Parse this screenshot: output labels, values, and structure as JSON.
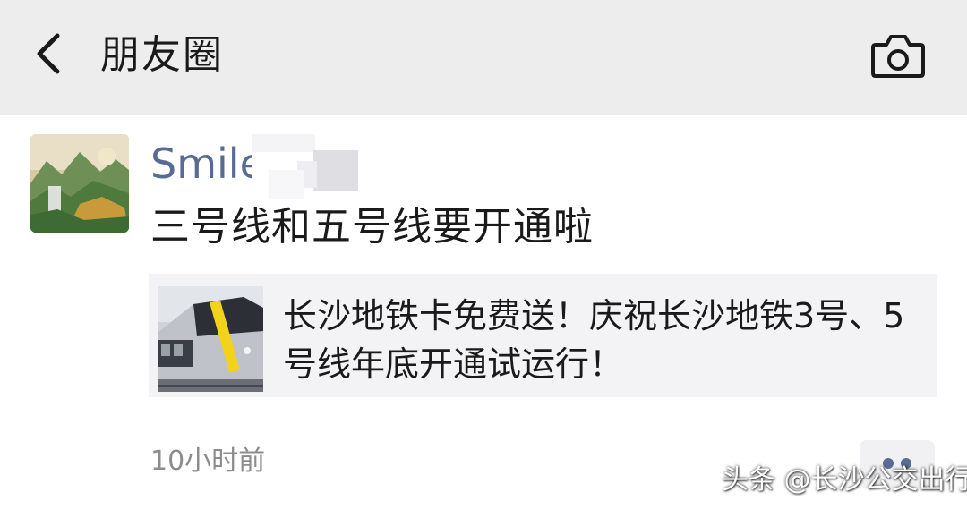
{
  "header": {
    "title": "朋友圈",
    "back_icon": "chevron-left-icon",
    "camera_icon": "camera-icon"
  },
  "post": {
    "username": "Smile",
    "text": "三号线和五号线要开通啦",
    "share": {
      "title": "长沙地铁卡免费送！庆祝长沙地铁3号、5号线年底开通试运行！"
    },
    "time": "10小时前",
    "more_icon": "more-dots-icon"
  },
  "watermark": "头条 @长沙公交出行",
  "colors": {
    "header_bg": "#ededed",
    "username": "#576b95",
    "card_bg": "#f3f3f5",
    "time": "#8c8c8c"
  }
}
